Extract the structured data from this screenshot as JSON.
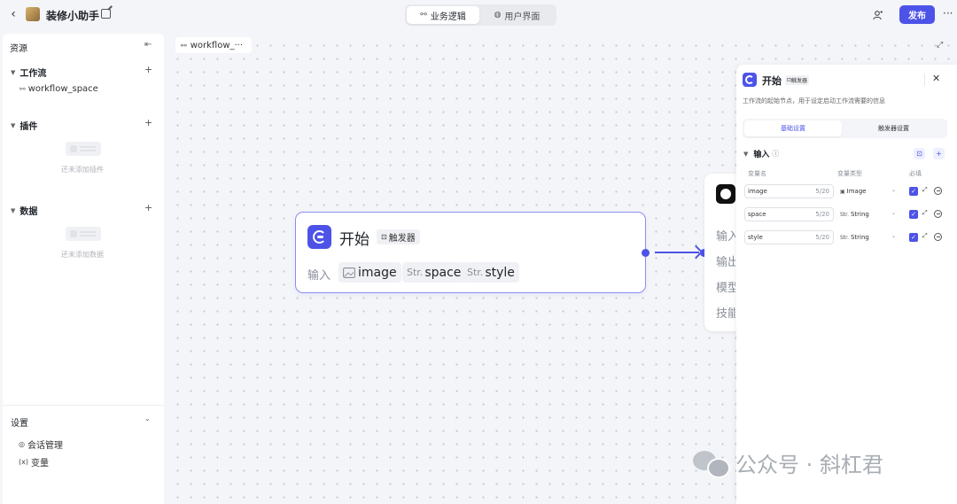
{
  "topbar": {
    "back_icon": "chevron-left-icon",
    "app_title": "装修小助手",
    "tabs": [
      {
        "label": "业务逻辑",
        "icon": "workflow-icon",
        "active": true
      },
      {
        "label": "用户界面",
        "icon": "ui-icon",
        "active": false
      }
    ],
    "publish_label": "发布",
    "accent": "#4d53e8"
  },
  "sidebar": {
    "header": "资源",
    "sections": {
      "workflow": {
        "title": "工作流",
        "items": [
          {
            "label": "workflow_space"
          }
        ]
      },
      "plugins": {
        "title": "插件",
        "empty_text": "还未添加插件"
      },
      "data": {
        "title": "数据",
        "empty_text": "还未添加数据"
      }
    },
    "settings": {
      "title": "设置",
      "items": [
        {
          "label": "会话管理",
          "icon": "chat-icon"
        },
        {
          "label": "变量",
          "icon": "variable-icon",
          "prefix": "(x)"
        }
      ]
    }
  },
  "canvas": {
    "tab_label": "workflow_···",
    "start_node": {
      "title": "开始",
      "badge": "触发器",
      "input_label": "输入",
      "vars": [
        {
          "type": "image-icon",
          "type_label": "",
          "name": "image"
        },
        {
          "type": "string",
          "type_label": "Str.",
          "name": "space"
        },
        {
          "type": "string",
          "type_label": "Str.",
          "name": "style"
        }
      ]
    },
    "next_node": {
      "labels": [
        "输入",
        "输出",
        "模型",
        "技能"
      ]
    }
  },
  "panel": {
    "title": "开始",
    "badge": "触发器",
    "description": "工作流的起始节点，用于设定启动工作流需要的信息",
    "tabs": [
      "基础设置",
      "触发器设置"
    ],
    "section": "输入",
    "columns": [
      "变量名",
      "变量类型",
      "必填"
    ],
    "rows": [
      {
        "name": "image",
        "count": "5/20",
        "type": "Image",
        "type_icon": "image-icon",
        "required": true
      },
      {
        "name": "space",
        "count": "5/20",
        "type": "String",
        "type_prefix": "Str.",
        "required": true
      },
      {
        "name": "style",
        "count": "5/20",
        "type": "String",
        "type_prefix": "Str.",
        "required": true
      }
    ]
  },
  "watermark": "公众号 · 斜杠君"
}
